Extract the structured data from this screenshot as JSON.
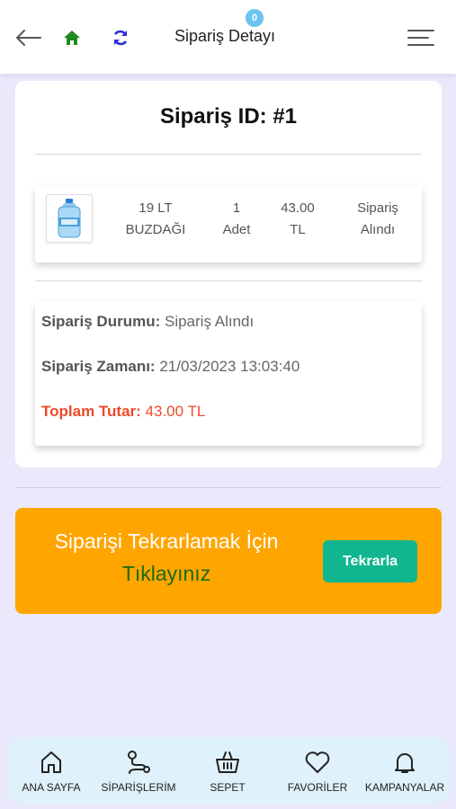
{
  "header": {
    "title": "Sipariş Detayı",
    "icons": [
      "arrow-left-icon",
      "home-icon",
      "refresh-icon",
      "menu-icon"
    ],
    "home_color": "#1f8a1f",
    "refresh_color": "#2d2dd6"
  },
  "order": {
    "id_label": "Sipariş ID: #1",
    "item": {
      "name_line1": "19 LT",
      "name_line2": "BUZDAĞI",
      "qty_line1": "1",
      "qty_line2": "Adet",
      "price_line1": "43.00",
      "price_line2": "TL",
      "status_line1": "Sipariş",
      "status_line2": "Alındı"
    },
    "status_label": "Sipariş Durumu:",
    "status_value": "Sipariş Alındı",
    "time_label": "Sipariş Zamanı:",
    "time_value": "21/03/2023 13:03:40",
    "total_label": "Toplam Tutar:",
    "total_value": "43.00 TL"
  },
  "repeat": {
    "text_line1": "Siparişi Tekrarlamak İçin",
    "text_line2": "Tıklayınız",
    "button_label": "Tekrarla",
    "banner_color": "#ffa500",
    "button_color": "#11b68e"
  },
  "bottom_nav": {
    "items": [
      {
        "label": "ANA SAYFA",
        "icon": "home-outline-icon"
      },
      {
        "label": "SİPARİŞLERİM",
        "icon": "route-icon"
      },
      {
        "label": "SEPET",
        "icon": "basket-icon"
      },
      {
        "label": "FAVORİLER",
        "icon": "heart-icon"
      },
      {
        "label": "KAMPANYALAR",
        "icon": "bell-icon"
      }
    ],
    "cart_badge": "0"
  }
}
